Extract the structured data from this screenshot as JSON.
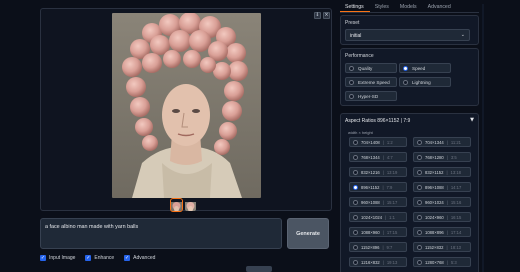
{
  "gallery": {
    "btn_minimize": "⇓",
    "btn_close": "×"
  },
  "prompt": {
    "value": "a face albino man made with yarn balls"
  },
  "generate_label": "Generate",
  "options": [
    {
      "label": "Input Image",
      "checked": true
    },
    {
      "label": "Enhance",
      "checked": true
    },
    {
      "label": "Advanced",
      "checked": true
    }
  ],
  "tabs": [
    "Settings",
    "Styles",
    "Models",
    "Advanced"
  ],
  "preset": {
    "label": "Preset",
    "value": "initial"
  },
  "performance": {
    "label": "Performance",
    "options": [
      "Quality",
      "Speed",
      "Extreme Speed",
      "Lightning",
      "Hyper-SD"
    ],
    "selected": "Speed"
  },
  "aspect": {
    "title": "Aspect Ratios 896×1152 | 7:9",
    "subtitle": "width × height",
    "items": [
      {
        "size": "704×1408",
        "ratio": "1:2"
      },
      {
        "size": "704×1344",
        "ratio": "11:21"
      },
      {
        "size": "768×1344",
        "ratio": "4:7"
      },
      {
        "size": "768×1280",
        "ratio": "3:5"
      },
      {
        "size": "832×1216",
        "ratio": "13:19"
      },
      {
        "size": "832×1152",
        "ratio": "13:18"
      },
      {
        "size": "896×1152",
        "ratio": "7:9"
      },
      {
        "size": "896×1088",
        "ratio": "14:17"
      },
      {
        "size": "960×1088",
        "ratio": "15:17"
      },
      {
        "size": "960×1024",
        "ratio": "15:16"
      },
      {
        "size": "1024×1024",
        "ratio": "1:1"
      },
      {
        "size": "1024×960",
        "ratio": "16:15"
      },
      {
        "size": "1088×960",
        "ratio": "17:15"
      },
      {
        "size": "1088×896",
        "ratio": "17:14"
      },
      {
        "size": "1152×896",
        "ratio": "9:7"
      },
      {
        "size": "1152×832",
        "ratio": "18:13"
      },
      {
        "size": "1216×832",
        "ratio": "19:13"
      },
      {
        "size": "1280×768",
        "ratio": "5:3"
      }
    ],
    "selected": "896×1152"
  },
  "colors": {
    "accent": "#2563eb",
    "background": "#0b0f19",
    "panel": "#111827"
  }
}
